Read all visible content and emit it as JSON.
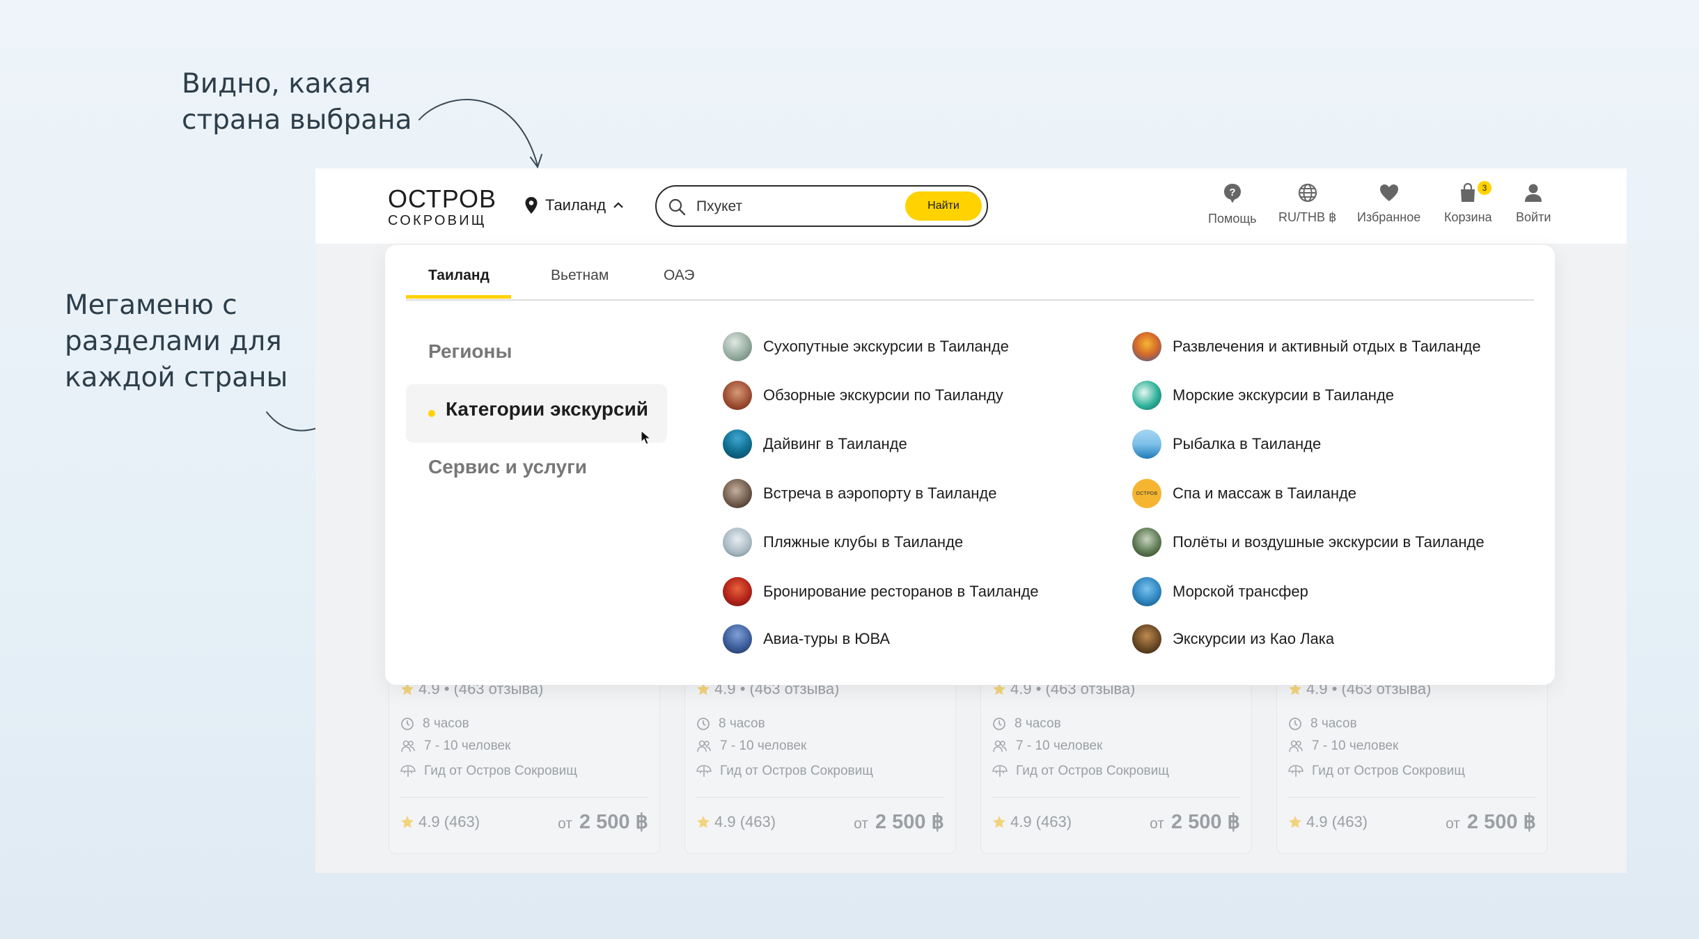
{
  "annotations": {
    "top_line1": "Видно, какая",
    "top_line2": "страна выбрана",
    "left_line1": "Мегаменю с",
    "left_line2": "разделами для",
    "left_line3": "каждой страны"
  },
  "header": {
    "logo_main": "ОСТРОВ",
    "logo_sub": "СОКРОВИЩ",
    "country": "Таиланд",
    "search_value": "Пхукет",
    "search_button": "Найти",
    "nav": {
      "help": "Помощь",
      "currency": "RU/THB ฿",
      "favorites": "Избранное",
      "cart": "Корзина",
      "cart_count": "3",
      "login": "Войти"
    }
  },
  "mega": {
    "tabs": [
      "Таиланд",
      "Вьетнам",
      "ОАЭ"
    ],
    "sections": [
      "Регионы",
      "Категории экскурсий",
      "Сервис и услуги"
    ],
    "items_left": [
      "Сухопутные экскурсии в Таиланде",
      "Обзорные экскурсии по Таиланду",
      "Дайвинг в Таиланде",
      "Встреча в аэропорту в Таиланде",
      "Пляжные клубы в Таиланде",
      "Бронирование ресторанов в Таиланде",
      "Авиа-туры в ЮВА"
    ],
    "items_right": [
      "Развлечения и активный отдых в Таиланде",
      "Морские экскурсии в Таиланде",
      "Рыбалка в Таиланде",
      "Спа и массаж в Таиланде",
      "Полёты и воздушные экскурсии в Таиланде",
      "Морской трансфер",
      "Экскурсии из Као Лака"
    ],
    "spa_icon_text": "ОСТРОВ"
  },
  "card": {
    "rating": "4.9 • (463 отзыва)",
    "duration": "8 часов",
    "group": "7 - 10 человек",
    "guide": "Гид от Остров Сокровищ",
    "rating_short": "4.9 (463)",
    "from": "от",
    "price": "2 500 ฿"
  },
  "colors": {
    "accent": "#ffd200",
    "text": "#1d1d1d",
    "muted": "#9b9fa4"
  }
}
